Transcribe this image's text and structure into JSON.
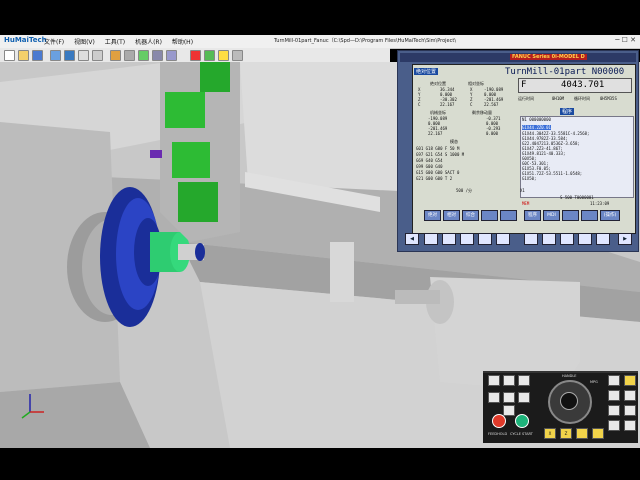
{
  "app": {
    "logo": "HuMaiTech",
    "menu": [
      "文件(F)",
      "视图(V)",
      "工具(T)",
      "机器人(R)",
      "帮助(H)"
    ],
    "window_title": "TurnMill-01part_Fanuc（C:\\Spd—D:\\Program Files\\HuMaiTech\\Sim\\Project\\"
  },
  "cnc": {
    "brand": "FANUC Series 0i-MODEL D",
    "program_header": "TurnMill-01part N00000",
    "feed_label": "F",
    "feed_value": "4043.701",
    "absolute_title": "绝对位置",
    "relative_title": "相对坐标",
    "machine_title": "机械坐标",
    "remaining_title": "剩余移动量",
    "modal_title": "模态",
    "program_title": "程序",
    "axes": [
      "X",
      "Y",
      "Z",
      "C"
    ],
    "abs_values": [
      "36.344",
      "0.000",
      "-30.302",
      "22.167"
    ],
    "rel_values": [
      "-190.089",
      "0.000",
      "-201.469",
      "22.567"
    ],
    "mach_values": [
      "-190.089",
      "0.000",
      "-201.469",
      "22.167"
    ],
    "rem_values": [
      "-0.371",
      "0.000",
      "-0.293",
      "0.000"
    ],
    "run_time_label": "运行时间",
    "run_time_value": "0H10M",
    "cycle_time_label": "循环时间",
    "cycle_time_value": "0H5M35S",
    "modal_rows": [
      "G01 G18 G80 F 50 M",
      "G97 G21 G54 S 1000 M",
      "G69 G40 G54",
      "G99 G00 G40",
      "G15 G00 G00 SACT 0",
      "G21 G00 G00 T 2"
    ],
    "speed_line": "500 /分",
    "program_lines": [
      "N1 000000000",
      "G1X44.2Z0.01",
      "G1X44.3042Z-33.5581C-4.2568;",
      "G1X44.9782Z-33.584;",
      "G22.4047213.0536Z-3.658;",
      "G1X47.2Z3-41.867;",
      "G1X49.8121-40.333;",
      "G0X50;",
      "G0C-53.301;",
      "G1X53.F0.05;",
      "G1X51.72Z-53.5511-1.0548;",
      "G1X50;"
    ],
    "status_line": "S  500  T0000001",
    "mem_label": "MEM",
    "time_display": "11:23:09",
    "softkeys": [
      "绝对",
      "相对",
      "综合",
      "",
      "",
      "程序",
      "MDI",
      "",
      "",
      "(操作)"
    ],
    "status_small": "X1"
  },
  "operator_panel": {
    "labels": [
      "FEEDHOLD",
      "CYCLE START",
      "HANDLE",
      "MPG",
      "X",
      "Z"
    ]
  }
}
